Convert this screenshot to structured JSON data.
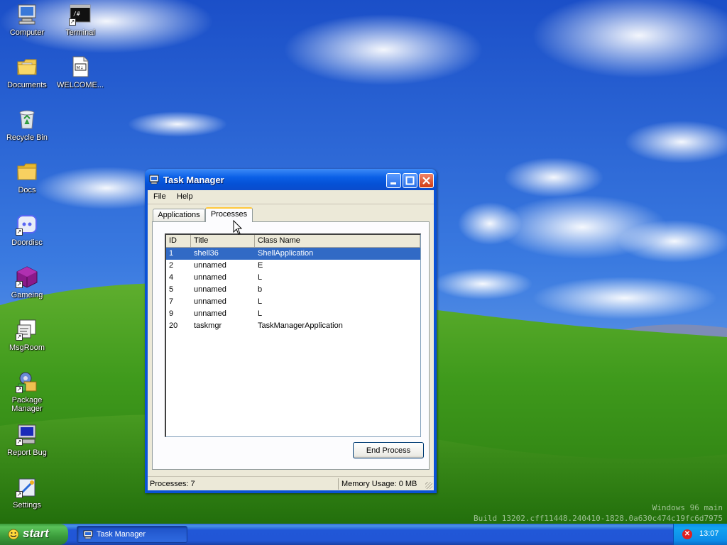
{
  "desktop": {
    "icons": [
      {
        "label": "Computer",
        "icon": "computer-icon"
      },
      {
        "label": "Terminal",
        "icon": "terminal-icon"
      },
      {
        "label": "Documents",
        "icon": "documents-folder-icon"
      },
      {
        "label": "WELCOME...",
        "icon": "markdown-file-icon"
      },
      {
        "label": "Recycle Bin",
        "icon": "recycle-bin-icon"
      },
      {
        "label": "Docs",
        "icon": "folder-icon"
      },
      {
        "label": "Doordisc",
        "icon": "discord-icon"
      },
      {
        "label": "Gameing",
        "icon": "game-cube-icon"
      },
      {
        "label": "MsgRoom",
        "icon": "msgroom-icon"
      },
      {
        "label": "Package Manager",
        "icon": "package-manager-icon"
      },
      {
        "label": "Report Bug",
        "icon": "report-bug-icon"
      },
      {
        "label": "Settings",
        "icon": "settings-icon"
      }
    ],
    "watermark": {
      "line1": "Windows 96 main",
      "line2": "Build 13202.cff11448.240410-1828.0a630c474c19fc6d7975"
    }
  },
  "window": {
    "title": "Task Manager",
    "menu": [
      "File",
      "Help"
    ],
    "tabs": [
      "Applications",
      "Processes"
    ],
    "active_tab": "Processes",
    "columns": [
      "ID",
      "Title",
      "Class Name"
    ],
    "rows": [
      {
        "id": "1",
        "title": "shell36",
        "class_name": "ShellApplication",
        "selected": true
      },
      {
        "id": "2",
        "title": "unnamed",
        "class_name": "E"
      },
      {
        "id": "4",
        "title": "unnamed",
        "class_name": "L"
      },
      {
        "id": "5",
        "title": "unnamed",
        "class_name": "b"
      },
      {
        "id": "7",
        "title": "unnamed",
        "class_name": "L"
      },
      {
        "id": "9",
        "title": "unnamed",
        "class_name": "L"
      },
      {
        "id": "20",
        "title": "taskmgr",
        "class_name": "TaskManagerApplication"
      }
    ],
    "end_process_label": "End Process",
    "status": {
      "processes": "Processes: 7",
      "memory": "Memory Usage: 0 MB"
    }
  },
  "taskbar": {
    "start_label": "start",
    "tasks": [
      {
        "label": "Task Manager",
        "icon": "task-manager-icon"
      }
    ],
    "tray": {
      "alert_icon": "error-icon",
      "clock": "13:07"
    }
  },
  "colors": {
    "selection": "#316ac5",
    "titlebar": "#0a5fe6",
    "taskbar": "#2156d6",
    "start": "#3b9c3b",
    "tray": "#0c8ce8",
    "window_face": "#ece9d8"
  }
}
